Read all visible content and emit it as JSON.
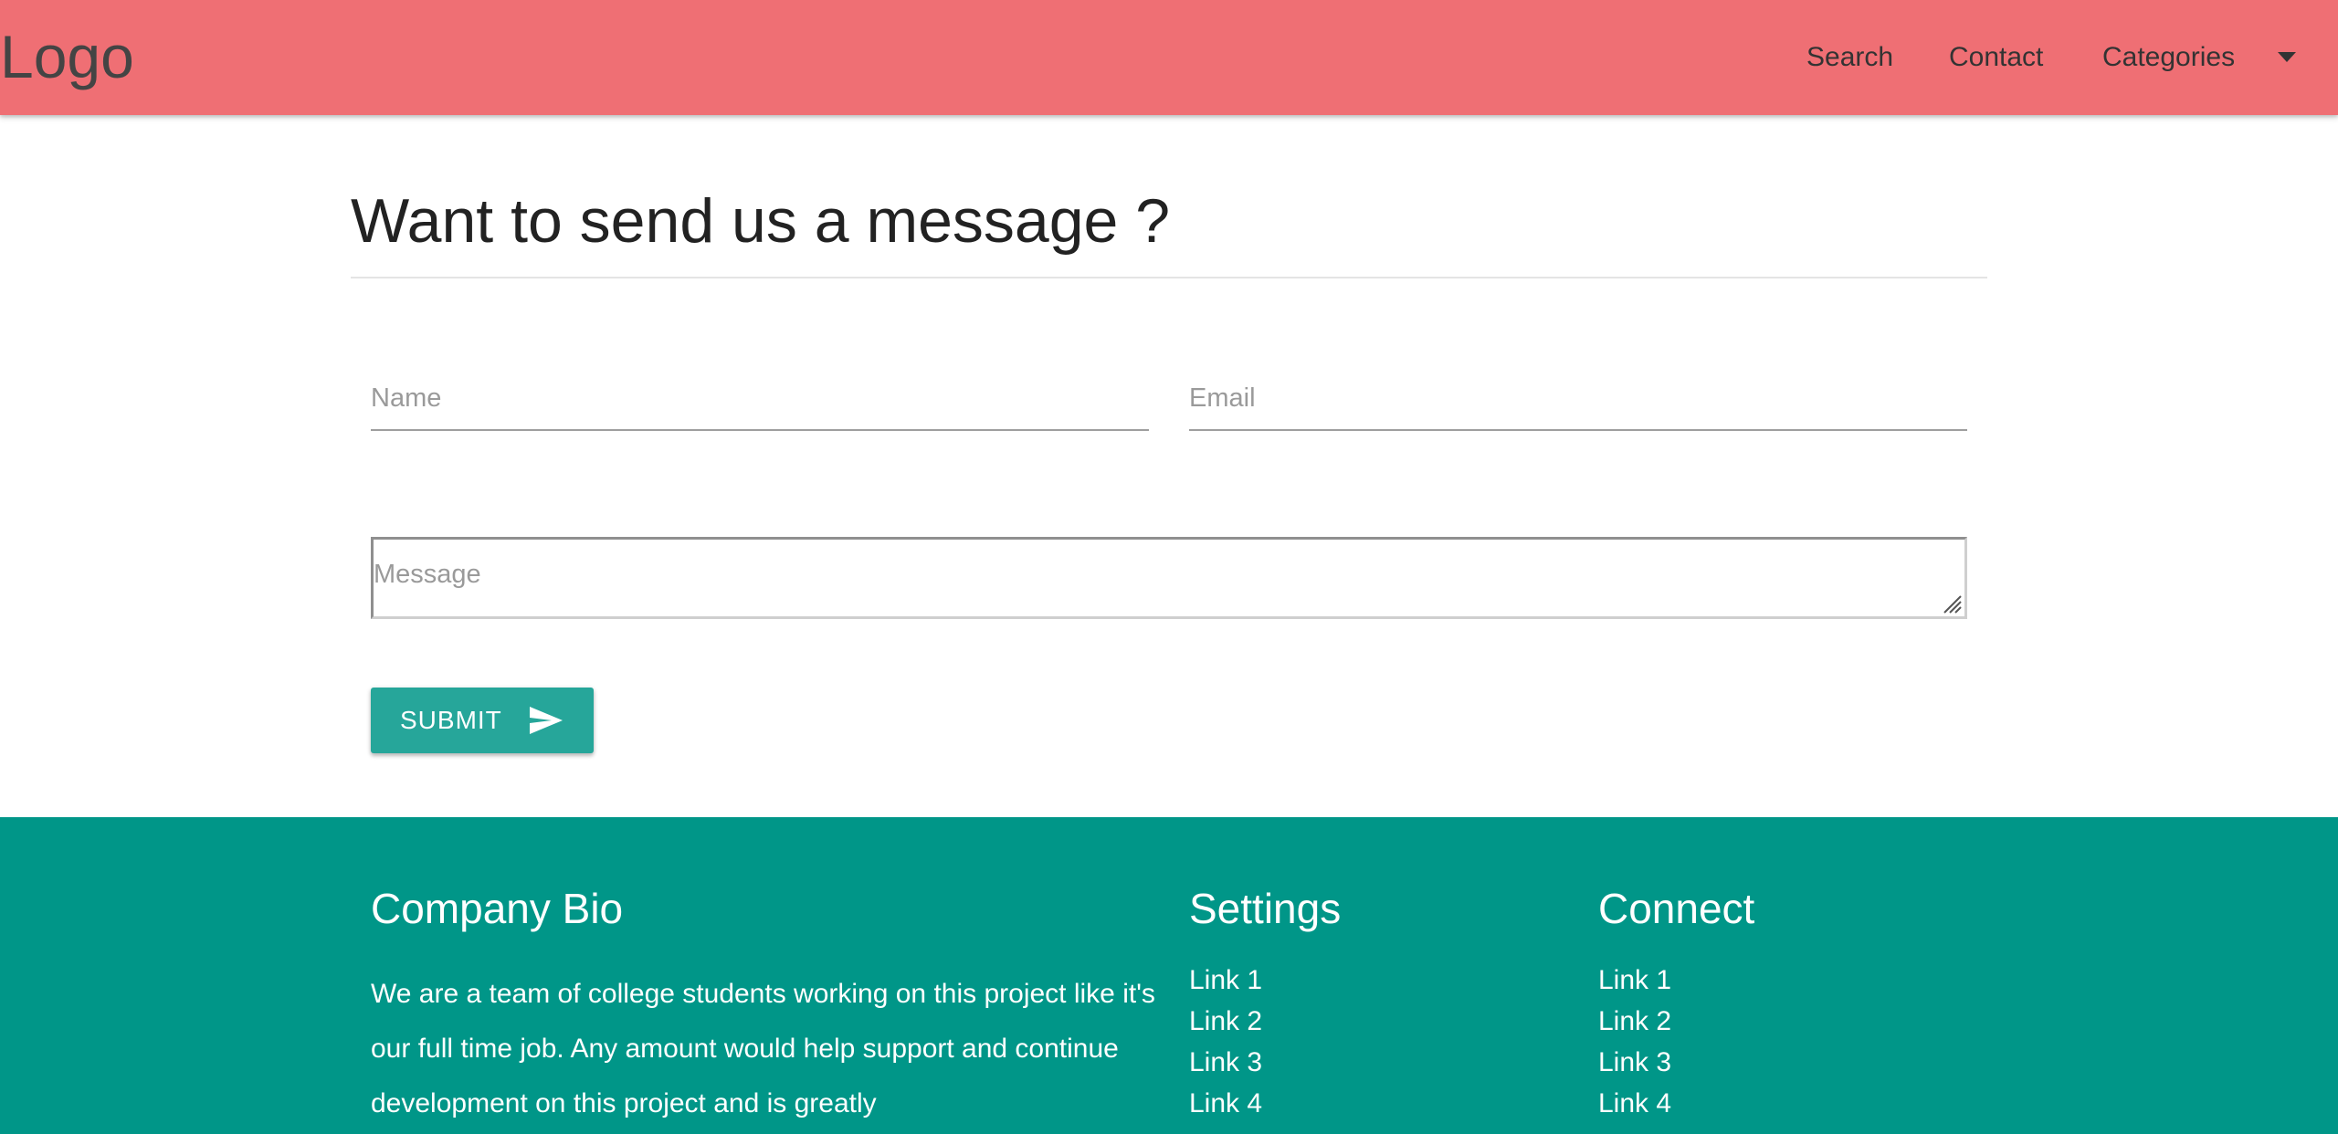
{
  "nav": {
    "logo": "Logo",
    "items": [
      {
        "label": "Search"
      },
      {
        "label": "Contact"
      },
      {
        "label": "Categories"
      }
    ],
    "dropdown_icon": "caret-down-icon",
    "background": "#ef6f74"
  },
  "main": {
    "title": "Want to send us a message ?",
    "form": {
      "name_placeholder": "Name",
      "name_value": "",
      "email_placeholder": "Email",
      "email_value": "",
      "message_placeholder": "Message",
      "message_value": "",
      "submit_label": "SUBMIT",
      "submit_icon": "send-icon",
      "button_color": "#26a69a"
    }
  },
  "footer": {
    "background": "#009688",
    "bio": {
      "title": "Company Bio",
      "text": "We are a team of college students working on this project like it's our full time job. Any amount would help support and continue development on this project and is greatly"
    },
    "settings": {
      "title": "Settings",
      "links": [
        "Link 1",
        "Link 2",
        "Link 3",
        "Link 4"
      ]
    },
    "connect": {
      "title": "Connect",
      "links": [
        "Link 1",
        "Link 2",
        "Link 3",
        "Link 4"
      ]
    }
  }
}
